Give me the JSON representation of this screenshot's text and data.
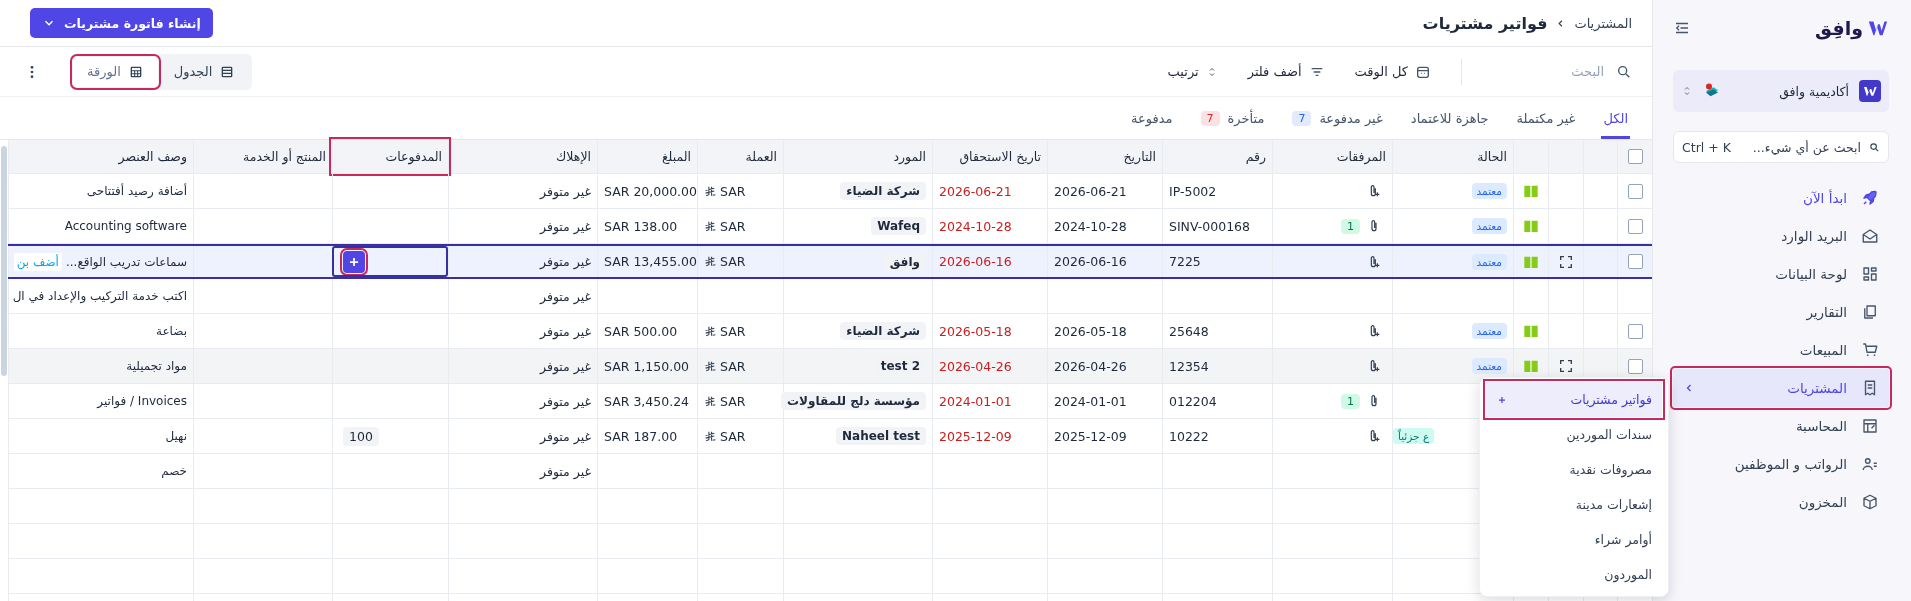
{
  "sidebar": {
    "brand": "وافِق",
    "org": {
      "name": "أكاديمية وافق"
    },
    "search": {
      "placeholder": "ابحث عن أي شيء...",
      "shortcut": "Ctrl + K"
    },
    "items": [
      {
        "label": "ابدأ الآن",
        "kind": "promo",
        "selected": false,
        "highlighted": false
      },
      {
        "label": "البريد الوارد",
        "kind": "page",
        "selected": false,
        "highlighted": false
      },
      {
        "label": "لوحة البيانات",
        "kind": "page",
        "selected": false,
        "highlighted": false
      },
      {
        "label": "التقارير",
        "kind": "page",
        "selected": false,
        "highlighted": false
      },
      {
        "label": "المبيعات",
        "kind": "page",
        "selected": false,
        "highlighted": false
      },
      {
        "label": "المشتريات",
        "kind": "page",
        "selected": true,
        "highlighted": true
      },
      {
        "label": "المحاسبة",
        "kind": "page",
        "selected": false,
        "highlighted": false
      },
      {
        "label": "الرواتب و الموظفين",
        "kind": "page",
        "selected": false,
        "highlighted": false
      },
      {
        "label": "المخزون",
        "kind": "page",
        "selected": false,
        "highlighted": false
      }
    ]
  },
  "submenu": {
    "items": [
      {
        "label": "فواتير مشتريات",
        "selected": true,
        "highlighted": true
      },
      {
        "label": "سندات الموردين",
        "selected": false,
        "highlighted": false
      },
      {
        "label": "مصروفات نقدية",
        "selected": false,
        "highlighted": false
      },
      {
        "label": "إشعارات مدينة",
        "selected": false,
        "highlighted": false
      },
      {
        "label": "أوامر شراء",
        "selected": false,
        "highlighted": false
      },
      {
        "label": "الموردون",
        "selected": false,
        "highlighted": false
      }
    ]
  },
  "header": {
    "breadcrumb": "المشتريات",
    "title": "فواتير مشتريات",
    "create_button": "إنشاء فاتورة مشتريات"
  },
  "toolbar": {
    "search": {
      "placeholder": "البحث"
    },
    "period": "كل الوقت",
    "filter": "أضف فلتر",
    "sort": "ترتيب",
    "views": [
      {
        "label": "الجدول",
        "selected": false,
        "highlighted": false
      },
      {
        "label": "الورقة",
        "selected": true,
        "highlighted": true
      }
    ]
  },
  "tabs": [
    {
      "label": "الكل",
      "selected": true
    },
    {
      "label": "غير مكتملة",
      "selected": false
    },
    {
      "label": "جاهزة للاعتماد",
      "selected": false
    },
    {
      "label": "غير مدفوعة",
      "selected": false,
      "count": "7",
      "color": "#2563eb"
    },
    {
      "label": "متأخرة",
      "selected": false,
      "count": "7",
      "color": "#dc2626"
    },
    {
      "label": "مدفوعة",
      "selected": false
    }
  ],
  "table": {
    "select_all": {
      "checked": false
    },
    "columns": [
      {
        "label": "الحالة",
        "highlighted": false
      },
      {
        "label": "المرفقات",
        "highlighted": false
      },
      {
        "label": "رقم",
        "highlighted": false
      },
      {
        "label": "التاريخ",
        "highlighted": false
      },
      {
        "label": "تاريخ الاستحقاق",
        "highlighted": false
      },
      {
        "label": "المورد",
        "highlighted": false
      },
      {
        "label": "العملة",
        "highlighted": false
      },
      {
        "label": "المبلغ",
        "highlighted": false
      },
      {
        "label": "الإهلاك",
        "highlighted": false
      },
      {
        "label": "المدفوعات",
        "highlighted": true
      },
      {
        "label": "المنتج أو الخدمة",
        "highlighted": false
      },
      {
        "label": "وصف العنصر",
        "highlighted": false
      }
    ],
    "rows": [
      {
        "kind": "invoice",
        "selected": false,
        "hovered": false,
        "checked": false,
        "posted": true,
        "status": {
          "text": "معتمد",
          "kind": "approved"
        },
        "attachments": {
          "kind": "add"
        },
        "number": "IP-5002",
        "date": "2026-06-21",
        "due_date": "2026-06-21",
        "supplier": "شركة الضياء",
        "currency": "SAR",
        "amount": "SAR 20,000.00",
        "depreciation": "غير متوفر",
        "description": "أضافة رصيد أفتتاحى"
      },
      {
        "kind": "invoice",
        "selected": false,
        "hovered": false,
        "checked": false,
        "posted": true,
        "status": {
          "text": "معتمد",
          "kind": "approved"
        },
        "attachments": {
          "kind": "file",
          "count": "1"
        },
        "number": "SINV-000168",
        "date": "2024-10-28",
        "due_date": "2024-10-28",
        "supplier": "Wafeq",
        "currency": "SAR",
        "amount": "SAR 138.00",
        "depreciation": "غير متوفر",
        "description": "Accounting software"
      },
      {
        "kind": "invoice",
        "selected": true,
        "hovered": false,
        "checked": false,
        "posted": true,
        "status": {
          "text": "معتمد",
          "kind": "approved"
        },
        "attachments": {
          "kind": "add"
        },
        "number": "7225",
        "date": "2026-06-16",
        "due_date": "2026-06-16",
        "supplier": "وافق",
        "currency": "SAR",
        "amount": "SAR 13,455.00",
        "depreciation": "غير متوفر",
        "payments_add": {
          "focused": true,
          "highlighted": true
        },
        "description": "سماعات تدريب الواقع...",
        "add_line": "أضف بن"
      },
      {
        "kind": "line",
        "selected": false,
        "hovered": false,
        "depreciation": "غير متوفر",
        "description": "اكتب خدمة التركيب والإعداد في ال"
      },
      {
        "kind": "invoice",
        "selected": false,
        "hovered": false,
        "checked": false,
        "posted": true,
        "status": {
          "text": "معتمد",
          "kind": "approved"
        },
        "attachments": {
          "kind": "add"
        },
        "number": "25648",
        "date": "2026-05-18",
        "due_date": "2026-05-18",
        "supplier": "شركة الضياء",
        "currency": "SAR",
        "amount": "SAR 500.00",
        "depreciation": "غير متوفر",
        "description": "بضاعة"
      },
      {
        "kind": "invoice",
        "selected": false,
        "hovered": true,
        "checked": false,
        "posted": true,
        "status": {
          "text": "معتمد",
          "kind": "approved"
        },
        "attachments": {
          "kind": "add"
        },
        "number": "12354",
        "date": "2026-04-26",
        "due_date": "2026-04-26",
        "supplier": "test 2",
        "currency": "SAR",
        "amount": "SAR 1,150.00",
        "depreciation": "غير متوفر",
        "description": "مواد تجميلية"
      },
      {
        "kind": "invoice",
        "selected": false,
        "hovered": false,
        "attachments": {
          "kind": "file",
          "count": "1"
        },
        "number": "012204",
        "date": "2024-01-01",
        "due_date": "2024-01-01",
        "supplier": "مؤسسة دلج للمقاولات",
        "currency": "SAR",
        "amount": "SAR 3,450.24",
        "depreciation": "غير متوفر",
        "description": "Invoices / فواتير"
      },
      {
        "kind": "invoice",
        "selected": false,
        "hovered": false,
        "status": {
          "text": "ع جزئياً",
          "kind": "partial"
        },
        "attachments": {
          "kind": "add"
        },
        "number": "10222",
        "date": "2025-12-09",
        "due_date": "2025-12-09",
        "supplier": "Naheel test",
        "currency": "SAR",
        "amount": "SAR 187.00",
        "depreciation": "غير متوفر",
        "payments": "100",
        "description": "نهيل"
      },
      {
        "kind": "line",
        "selected": false,
        "hovered": false,
        "depreciation": "غير متوفر",
        "description": "خصم"
      }
    ]
  }
}
